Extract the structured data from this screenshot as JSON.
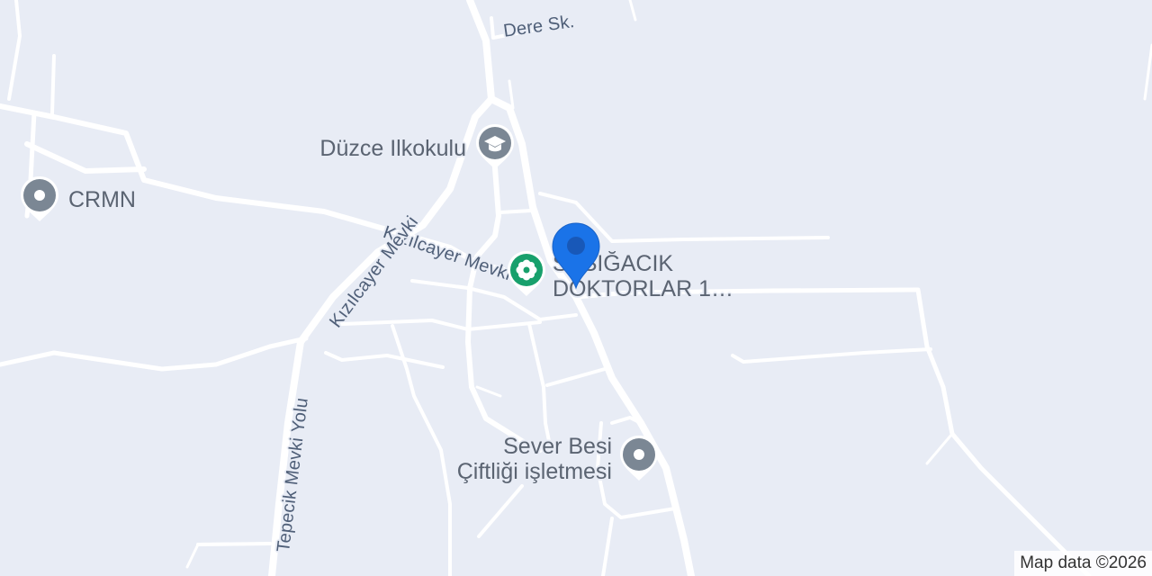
{
  "map": {
    "roads": {
      "dere_sk": "Dere Sk.",
      "kizilcayer_mevki_1": "Kızılcayer Mevki",
      "kizilcayer_mevki_2": "Kızılcayer Mevki",
      "tepecik_mevki_yolu": "Tepecik Mevki Yolu"
    },
    "pois": {
      "duzce_ilkokulu": {
        "name": "Düzce Ilkokulu",
        "icon": "graduation-cap-icon"
      },
      "crmn": {
        "name": "CRMN",
        "icon": "place-pin-icon"
      },
      "doktorlar": {
        "name_line1": "SIĞACIK",
        "name_line2": "DOKTORLAR 1…",
        "prefix": "S",
        "icon": "medical-flower-icon"
      },
      "sever_besi": {
        "name_line1": "Sever Besi",
        "name_line2": "Çiftliği işletmesi",
        "icon": "place-pin-icon"
      }
    },
    "selected_marker": {
      "icon": "location-marker-icon",
      "color": "#1a73e8"
    },
    "attribution": "Map data ©2026",
    "colors": {
      "background": "#e8ecf5",
      "road": "#ffffff",
      "pin_gray": "#7b8794",
      "pin_green": "#18a06c",
      "marker_blue": "#1a73e8"
    }
  }
}
